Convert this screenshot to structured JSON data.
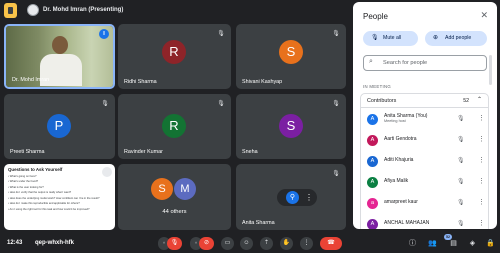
{
  "presenter": {
    "label": "Dr. Mohd Imran (Presenting)"
  },
  "tiles": {
    "self": {
      "name": "Dr. Mohd Imran"
    },
    "t1": {
      "name": "Ridhi Sharma",
      "initial": "R",
      "color": "#8e2429"
    },
    "t2": {
      "name": "Shivani Kashyap",
      "initial": "S",
      "color": "#e8711c"
    },
    "t3": {
      "name": "Preeti Sharma",
      "initial": "P",
      "color": "#1967d2"
    },
    "t4": {
      "name": "Ravinder Kumar",
      "initial": "R",
      "color": "#137333"
    },
    "t5": {
      "name": "Sneha",
      "initial": "S",
      "color": "#7b1fa2"
    },
    "others": {
      "label": "44 others",
      "initial1": "S",
      "initial2": "M",
      "color1": "#e8711c",
      "color2": "#5c6bc0"
    },
    "t7": {
      "name": "Anita Sharma"
    }
  },
  "screen_share": {
    "title": "Questions to Ask Yourself",
    "lines": [
      "• What's going on here?",
      "• What's under the hood?",
      "• What is the user looking for?",
      "• How do I verify that the output is really what I want?",
      "• How does the underlying model work? How confident can I be in the result?",
      "• How do I make this reproducible and applicable for others?",
      "• Am I using the right tool for this task and how could it be improved?"
    ]
  },
  "bottom": {
    "time": "12:43",
    "meeting_code": "qep-whxh-hfk",
    "badge": "52"
  },
  "panel": {
    "title": "People",
    "mute_all": "Mute all",
    "add_people": "Add people",
    "search_placeholder": "Search for people",
    "section": "IN MEETING",
    "contributors_label": "Contributors",
    "contributors_count": "52",
    "people": [
      {
        "name": "Anita Sharma (You)",
        "sub": "Meeting host",
        "initial": "A",
        "color": "#1a73e8"
      },
      {
        "name": "Aarti Gendotra",
        "sub": "",
        "initial": "A",
        "color": "#c2185b"
      },
      {
        "name": "Aditi Khajuria",
        "sub": "",
        "initial": "A",
        "color": "#1967d2"
      },
      {
        "name": "Afiya Malik",
        "sub": "",
        "initial": "A",
        "color": "#0b8043"
      },
      {
        "name": "amarpreet kaur",
        "sub": "",
        "initial": "a",
        "color": "#e52592"
      },
      {
        "name": "ANCHAL MAHAJAN",
        "sub": "",
        "initial": "A",
        "color": "#7b1fa2"
      }
    ]
  }
}
